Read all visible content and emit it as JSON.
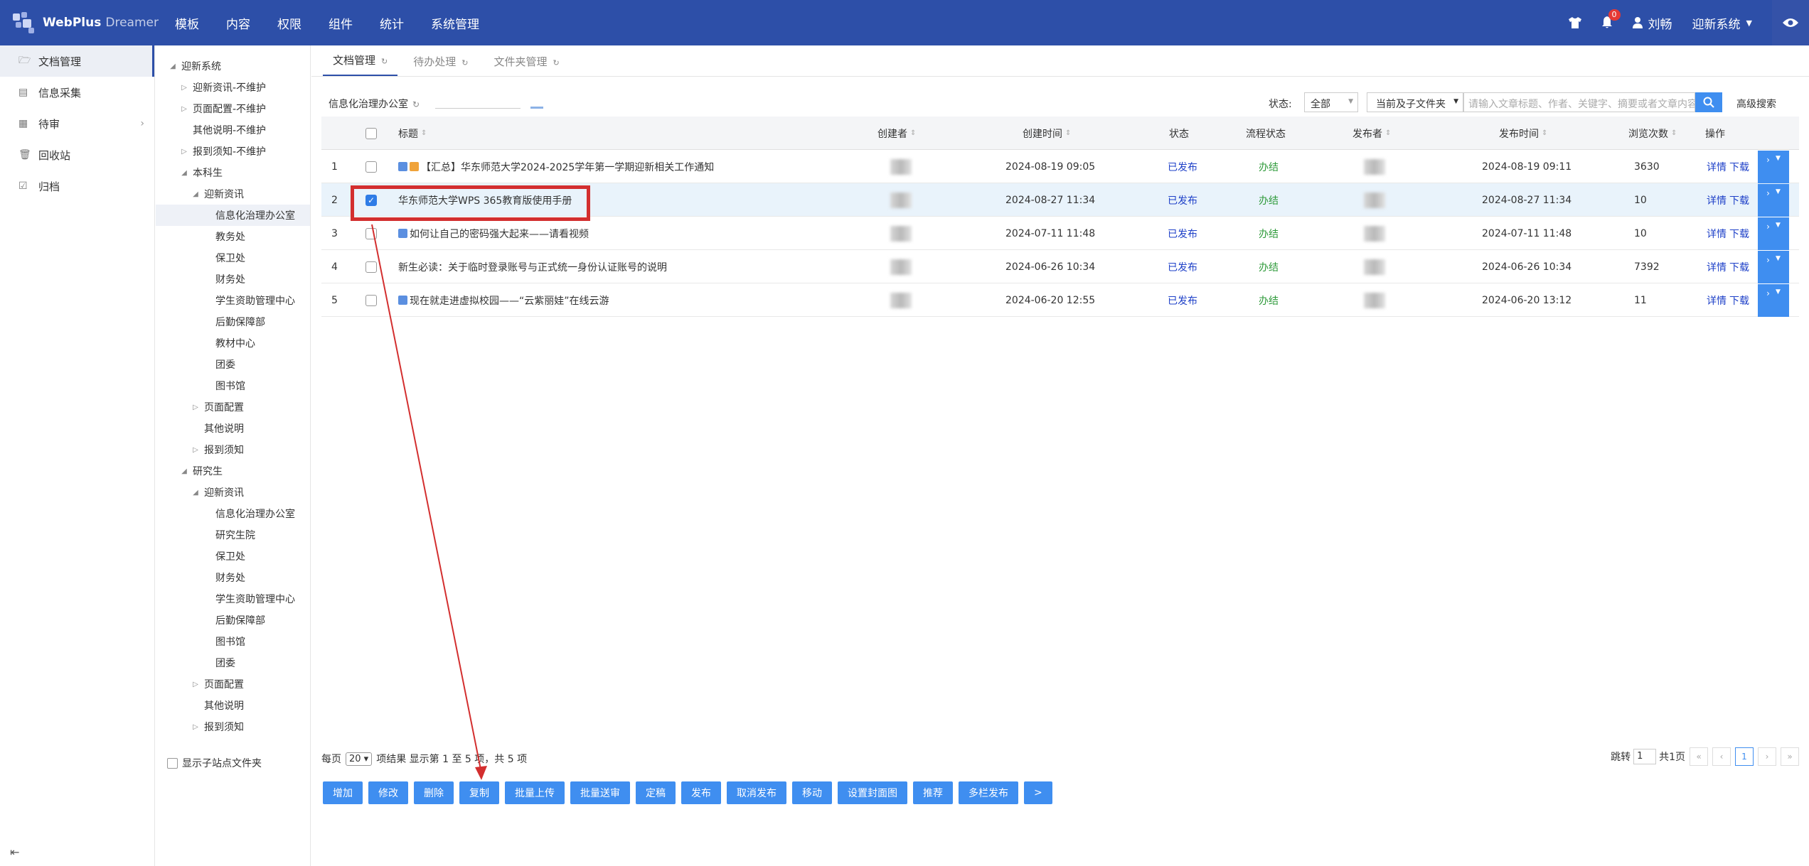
{
  "header": {
    "logo_main": "WebPlus",
    "logo_sub": "Dreamer",
    "nav": [
      "模板",
      "内容",
      "权限",
      "组件",
      "统计",
      "系统管理"
    ],
    "notification_count": "0",
    "user": "刘畅",
    "site": "迎新系统"
  },
  "sidebar": {
    "items": [
      {
        "label": "文档管理",
        "icon": "folder-icon"
      },
      {
        "label": "信息采集",
        "icon": "form-icon"
      },
      {
        "label": "待审",
        "icon": "review-icon"
      },
      {
        "label": "回收站",
        "icon": "trash-icon"
      },
      {
        "label": "归档",
        "icon": "archive-icon"
      }
    ]
  },
  "tree": {
    "nodes": [
      {
        "label": "迎新系统",
        "level": 0,
        "toggle": "expanded"
      },
      {
        "label": "迎新资讯-不维护",
        "level": 1,
        "toggle": "collapsed"
      },
      {
        "label": "页面配置-不维护",
        "level": 1,
        "toggle": "collapsed"
      },
      {
        "label": "其他说明-不维护",
        "level": 1,
        "toggle": "none"
      },
      {
        "label": "报到须知-不维护",
        "level": 1,
        "toggle": "collapsed"
      },
      {
        "label": "本科生",
        "level": 1,
        "toggle": "expanded"
      },
      {
        "label": "迎新资讯",
        "level": 2,
        "toggle": "expanded"
      },
      {
        "label": "信息化治理办公室",
        "level": 3,
        "toggle": "none",
        "selected": true
      },
      {
        "label": "教务处",
        "level": 3,
        "toggle": "none"
      },
      {
        "label": "保卫处",
        "level": 3,
        "toggle": "none"
      },
      {
        "label": "财务处",
        "level": 3,
        "toggle": "none"
      },
      {
        "label": "学生资助管理中心",
        "level": 3,
        "toggle": "none"
      },
      {
        "label": "后勤保障部",
        "level": 3,
        "toggle": "none"
      },
      {
        "label": "教材中心",
        "level": 3,
        "toggle": "none"
      },
      {
        "label": "团委",
        "level": 3,
        "toggle": "none"
      },
      {
        "label": "图书馆",
        "level": 3,
        "toggle": "none"
      },
      {
        "label": "页面配置",
        "level": 2,
        "toggle": "collapsed"
      },
      {
        "label": "其他说明",
        "level": 2,
        "toggle": "none"
      },
      {
        "label": "报到须知",
        "level": 2,
        "toggle": "collapsed"
      },
      {
        "label": "研究生",
        "level": 1,
        "toggle": "expanded"
      },
      {
        "label": "迎新资讯",
        "level": 2,
        "toggle": "expanded"
      },
      {
        "label": "信息化治理办公室",
        "level": 3,
        "toggle": "none"
      },
      {
        "label": "研究生院",
        "level": 3,
        "toggle": "none"
      },
      {
        "label": "保卫处",
        "level": 3,
        "toggle": "none"
      },
      {
        "label": "财务处",
        "level": 3,
        "toggle": "none"
      },
      {
        "label": "学生资助管理中心",
        "level": 3,
        "toggle": "none"
      },
      {
        "label": "后勤保障部",
        "level": 3,
        "toggle": "none"
      },
      {
        "label": "图书馆",
        "level": 3,
        "toggle": "none"
      },
      {
        "label": "团委",
        "level": 3,
        "toggle": "none"
      },
      {
        "label": "页面配置",
        "level": 2,
        "toggle": "collapsed"
      },
      {
        "label": "其他说明",
        "level": 2,
        "toggle": "none"
      },
      {
        "label": "报到须知",
        "level": 2,
        "toggle": "collapsed"
      }
    ],
    "show_sub_label": "显示子站点文件夹"
  },
  "tabs": [
    "文档管理",
    "待办处理",
    "文件夹管理"
  ],
  "filter": {
    "folder": "信息化治理办公室",
    "status_label": "状态:",
    "status_value": "全部",
    "scope_value": "当前及子文件夹",
    "search_placeholder": "请输入文章标题、作者、关键字、摘要或者文章内容",
    "advanced": "高级搜索"
  },
  "table": {
    "columns": [
      "标题",
      "创建者",
      "创建时间",
      "状态",
      "流程状态",
      "发布者",
      "发布时间",
      "浏览次数",
      "操作"
    ],
    "rows": [
      {
        "no": "1",
        "title": "【汇总】华东师范大学2024-2025学年第一学期迎新相关工作通知",
        "icons": [
          "img",
          "doc"
        ],
        "created": "2024-08-19 09:05",
        "status": "已发布",
        "flow": "办结",
        "published": "2024-08-19 09:11",
        "views": "3630",
        "checked": false
      },
      {
        "no": "2",
        "title": "华东师范大学WPS 365教育版使用手册",
        "icons": [],
        "created": "2024-08-27 11:34",
        "status": "已发布",
        "flow": "办结",
        "published": "2024-08-27 11:34",
        "views": "10",
        "checked": true
      },
      {
        "no": "3",
        "title": "如何让自己的密码强大起来——请看视频",
        "icons": [
          "img"
        ],
        "created": "2024-07-11 11:48",
        "status": "已发布",
        "flow": "办结",
        "published": "2024-07-11 11:48",
        "views": "10",
        "checked": false
      },
      {
        "no": "4",
        "title": "新生必读：关于临时登录账号与正式统一身份认证账号的说明",
        "icons": [],
        "created": "2024-06-26 10:34",
        "status": "已发布",
        "flow": "办结",
        "published": "2024-06-26 10:34",
        "views": "7392",
        "checked": false
      },
      {
        "no": "5",
        "title": "现在就走进虚拟校园——“云紫丽娃”在线云游",
        "icons": [
          "img"
        ],
        "created": "2024-06-20 12:55",
        "status": "已发布",
        "flow": "办结",
        "published": "2024-06-20 13:12",
        "views": "11",
        "checked": false
      }
    ],
    "op_detail": "详情",
    "op_download": "下载"
  },
  "pager": {
    "per_page_label": "每页",
    "per_page_value": "20",
    "summary": "项结果 显示第 1 至 5 项，共 5 项",
    "jump_label": "跳转",
    "jump_value": "1",
    "total_pages": "共1页",
    "current": "1"
  },
  "actions": [
    "增加",
    "修改",
    "删除",
    "复制",
    "批量上传",
    "批量送审",
    "定稿",
    "发布",
    "取消发布",
    "移动",
    "设置封面图",
    "推荐",
    "多栏发布",
    ">"
  ],
  "colors": {
    "header": "#2d4fa8",
    "primary": "#3f8ef0",
    "annotation": "#d32f2f"
  }
}
